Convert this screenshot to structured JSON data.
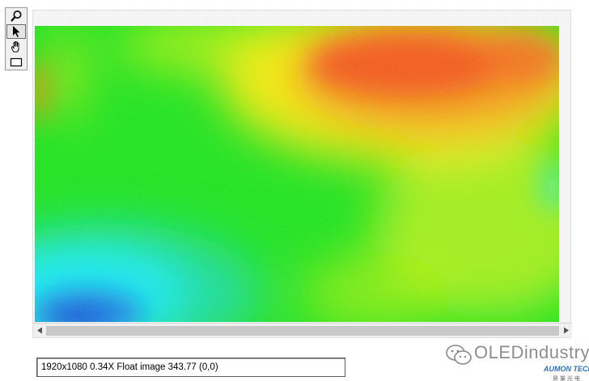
{
  "toolbar": {
    "tools": [
      {
        "name": "zoom",
        "icon": "magnifier-icon"
      },
      {
        "name": "select",
        "icon": "arrow-pointer-icon",
        "active": true
      },
      {
        "name": "pan",
        "icon": "hand-icon"
      },
      {
        "name": "region",
        "icon": "rectangle-icon"
      }
    ]
  },
  "viewer": {
    "colormap": [
      "#1030d0",
      "#10e8f0",
      "#10e010",
      "#e0f000",
      "#f07010",
      "#f04010"
    ]
  },
  "status": {
    "text": "1920x1080 0.34X Float image 343.77     (0,0)"
  },
  "watermark": {
    "text": "OLEDindustry",
    "brand": "AUMON TECH",
    "brand_cn": "昊 量 光 电"
  }
}
